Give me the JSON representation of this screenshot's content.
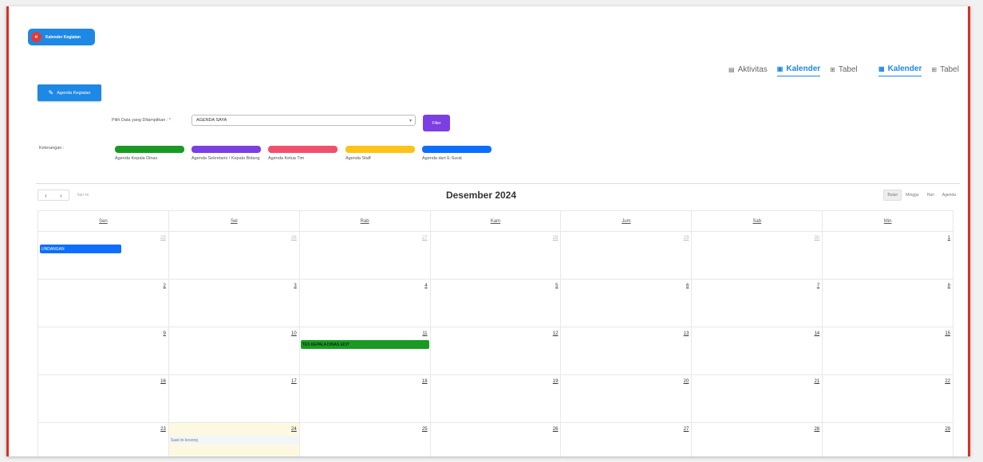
{
  "header": {
    "pill_icon": "«",
    "pill_label": "Kalender Kegiatan"
  },
  "tabs_group1": [
    {
      "icon": "▤",
      "label": "Aktivitas",
      "active": false
    },
    {
      "icon": "▣",
      "label": "Kalender",
      "active": true
    },
    {
      "icon": "⊞",
      "label": "Tabel",
      "active": false
    }
  ],
  "tabs_group2": [
    {
      "icon": "▦",
      "label": "Kalender",
      "active": true
    },
    {
      "icon": "⊞",
      "label": "Tabel",
      "active": false
    }
  ],
  "actions": {
    "agenda_button": "Agenda Kegiatan",
    "filter_button": "Filter"
  },
  "filter": {
    "label": "Pilih Data yang Ditampilkan :",
    "required_mark": "*",
    "selected": "AGENDA SAYA"
  },
  "legend": {
    "label": "Keterangan :",
    "items": [
      {
        "label": "Agenda Kepala Dinas",
        "color": "#1a9a23"
      },
      {
        "label": "Agenda Sekretaris / Kepala Bidang",
        "color": "#7b3fe4"
      },
      {
        "label": "Agenda Ketua Tim",
        "color": "#f0506e"
      },
      {
        "label": "Agenda Staff",
        "color": "#fcc419"
      },
      {
        "label": "Agenda dari E-Surat",
        "color": "#0d6efd"
      }
    ]
  },
  "calendar": {
    "title": "Desember 2024",
    "prev": "‹",
    "next": "›",
    "today_button": "hari ini",
    "views": [
      "Bulan",
      "Minggu",
      "Hari",
      "Agenda"
    ],
    "active_view": "Bulan",
    "day_headers": [
      "Sen",
      "Sel",
      "Rab",
      "Kam",
      "Jum",
      "Sab",
      "Min"
    ],
    "weeks": [
      [
        "25",
        "26",
        "27",
        "28",
        "29",
        "30",
        "1"
      ],
      [
        "2",
        "3",
        "4",
        "5",
        "6",
        "7",
        "8"
      ],
      [
        "9",
        "10",
        "11",
        "12",
        "13",
        "14",
        "15"
      ],
      [
        "16",
        "17",
        "18",
        "19",
        "20",
        "21",
        "22"
      ],
      [
        "23",
        "24",
        "25",
        "26",
        "27",
        "28",
        "29"
      ]
    ],
    "events": [
      {
        "title": "UNDANGAN",
        "color": "#0d6efd",
        "week": 0,
        "day": 0
      },
      {
        "title": "TES KEPALA DINAS EDIT",
        "color": "#1a9a23",
        "week": 2,
        "day": 2
      }
    ],
    "empty_note": "Saat ini kosong"
  }
}
